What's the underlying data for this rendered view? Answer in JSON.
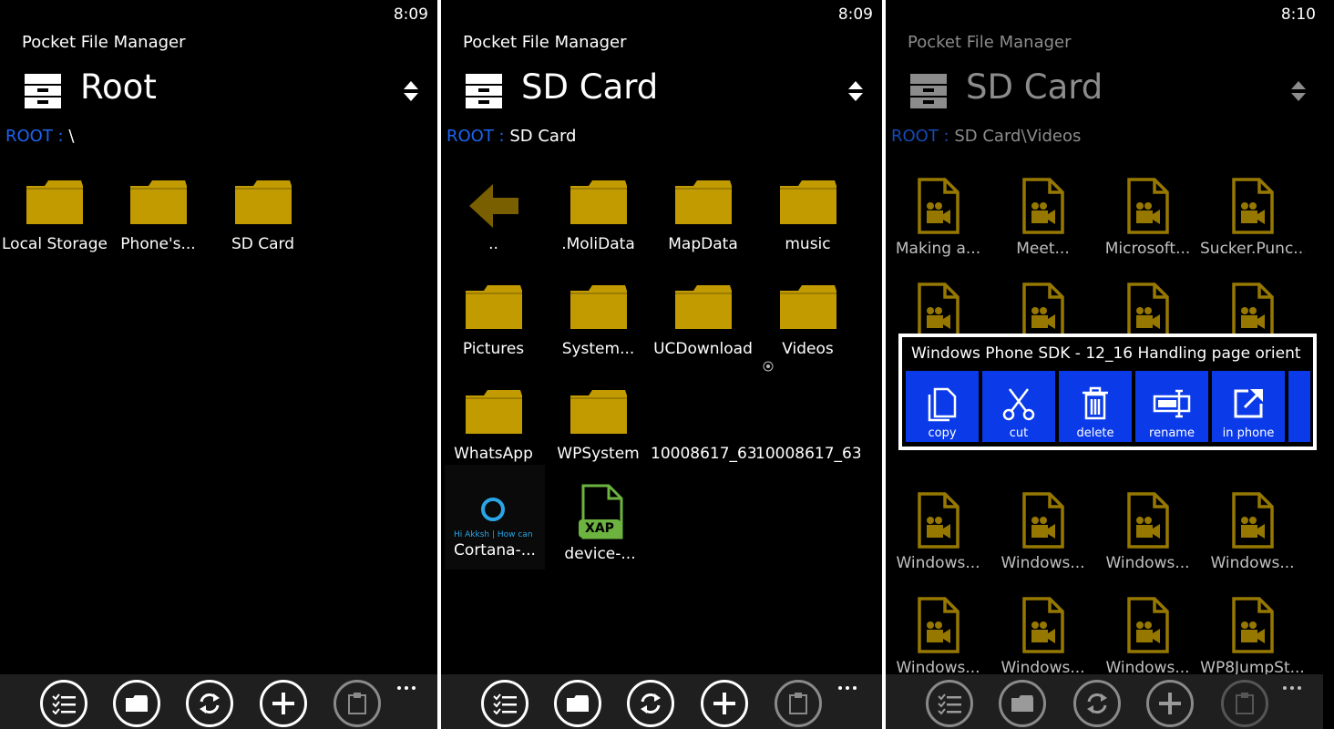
{
  "screens": [
    {
      "clock": "8:09",
      "app_name": "Pocket File Manager",
      "title": "Root",
      "crumb_root": "ROOT :",
      "crumb_path": " \\",
      "items": [
        {
          "label": "Local Storage",
          "icon": "folder-icon"
        },
        {
          "label": "Phone's...",
          "icon": "folder-icon"
        },
        {
          "label": "SD Card",
          "icon": "folder-icon"
        }
      ]
    },
    {
      "clock": "8:09",
      "app_name": "Pocket File Manager",
      "title": "SD Card",
      "crumb_root": "ROOT :",
      "crumb_path": " SD Card",
      "items": [
        {
          "label": "..",
          "icon": "back-arrow-icon"
        },
        {
          "label": ".MoliData",
          "icon": "folder-icon"
        },
        {
          "label": "MapData",
          "icon": "folder-icon"
        },
        {
          "label": "music",
          "icon": "folder-icon"
        },
        {
          "label": "Pictures",
          "icon": "folder-icon"
        },
        {
          "label": "System...",
          "icon": "folder-icon"
        },
        {
          "label": "UCDownload",
          "icon": "folder-icon"
        },
        {
          "label": "Videos",
          "icon": "folder-icon"
        },
        {
          "label": "WhatsApp",
          "icon": "folder-icon"
        },
        {
          "label": "WPSystem",
          "icon": "folder-icon"
        },
        {
          "label": "10008617_63...",
          "icon": "image-file-icon"
        },
        {
          "label": "10008617_63...",
          "icon": "image-file-icon"
        },
        {
          "label": "Cortana-...",
          "icon": "cortana-thumbnail-icon"
        },
        {
          "label": "device-...",
          "icon": "xap-file-icon"
        }
      ],
      "cortana_thumb_text": "Hi Akksh | How can I help you?",
      "xap_badge": "XAP"
    },
    {
      "clock": "8:10",
      "app_name": "Pocket File Manager",
      "title": "SD Card",
      "crumb_root": "ROOT :",
      "crumb_path": " SD Card\\Videos",
      "items": [
        {
          "label": "Making a...",
          "icon": "video-file-icon"
        },
        {
          "label": "Meet...",
          "icon": "video-file-icon"
        },
        {
          "label": "Microsoft...",
          "icon": "video-file-icon"
        },
        {
          "label": "Sucker.Punc...",
          "icon": "video-file-icon"
        },
        {
          "label": "",
          "icon": "video-file-icon"
        },
        {
          "label": "",
          "icon": "video-file-icon"
        },
        {
          "label": "",
          "icon": "video-file-icon"
        },
        {
          "label": "",
          "icon": "video-file-icon"
        },
        {
          "label": "Windows...",
          "icon": "video-file-icon"
        },
        {
          "label": "Windows...",
          "icon": "video-file-icon"
        },
        {
          "label": "Windows...",
          "icon": "video-file-icon"
        },
        {
          "label": "Windows...",
          "icon": "video-file-icon"
        },
        {
          "label": "Windows...",
          "icon": "video-file-icon"
        },
        {
          "label": "Windows...",
          "icon": "video-file-icon"
        },
        {
          "label": "Windows...",
          "icon": "video-file-icon"
        },
        {
          "label": "WP8JumpSt...",
          "icon": "video-file-icon"
        }
      ],
      "context_menu": {
        "title": "Windows Phone SDK - 12_16 Handling page orient",
        "actions": [
          {
            "label": "copy",
            "icon": "copy-icon"
          },
          {
            "label": "cut",
            "icon": "scissors-icon"
          },
          {
            "label": "delete",
            "icon": "trash-icon"
          },
          {
            "label": "rename",
            "icon": "rename-icon"
          },
          {
            "label": "in phone",
            "icon": "open-external-icon"
          }
        ]
      }
    }
  ],
  "app_bar": {
    "buttons": [
      {
        "icon": "select-list-icon",
        "enabled": true
      },
      {
        "icon": "folder-icon",
        "enabled": true
      },
      {
        "icon": "refresh-icon",
        "enabled": true
      },
      {
        "icon": "add-icon",
        "enabled": true
      },
      {
        "icon": "clipboard-icon",
        "enabled": false
      }
    ],
    "more": "more-icon"
  },
  "colors": {
    "background": "#000000",
    "folder": "#c29b00",
    "file_icon": "#c9a000",
    "accent_blue": "#0b3be8",
    "crumb_blue": "#1e63f0",
    "app_bar": "#1f1f1f"
  }
}
